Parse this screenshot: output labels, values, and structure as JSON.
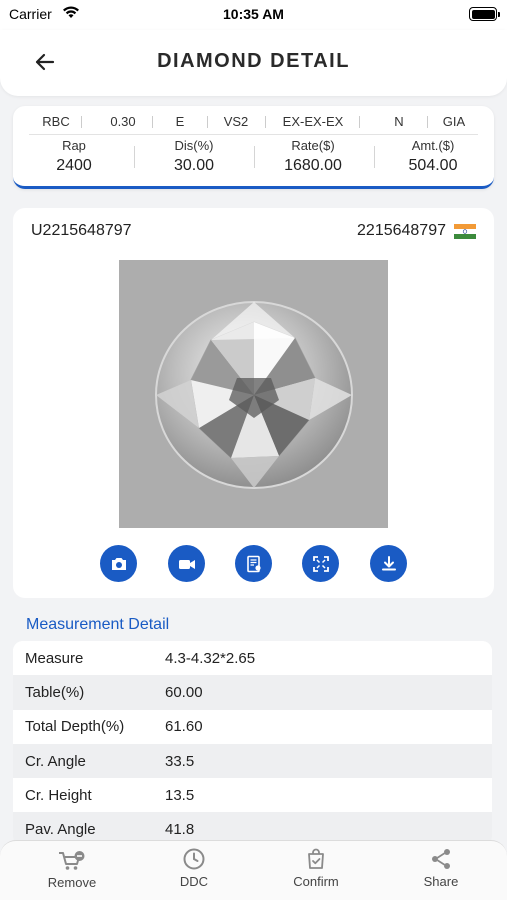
{
  "status_bar": {
    "carrier": "Carrier",
    "time": "10:35 AM"
  },
  "header": {
    "title": "DIAMOND DETAIL"
  },
  "summary": {
    "shape": "RBC",
    "carat": "0.30",
    "color": "E",
    "clarity": "VS2",
    "cut_pol_sym": "EX-EX-EX",
    "fluorescence": "N",
    "lab": "GIA",
    "columns": [
      {
        "label": "Rap",
        "value": "2400"
      },
      {
        "label": "Dis(%)",
        "value": "30.00"
      },
      {
        "label": "Rate($)",
        "value": "1680.00"
      },
      {
        "label": "Amt.($)",
        "value": "504.00"
      }
    ]
  },
  "stone": {
    "stone_id": "U2215648797",
    "certificate_no": "2215648797",
    "origin_flag": "india-flag-icon"
  },
  "actions": [
    "camera-icon",
    "video-icon",
    "certificate-icon",
    "fullscreen-icon",
    "download-icon"
  ],
  "measurement": {
    "title": "Measurement Detail",
    "rows": [
      {
        "key": "Measure",
        "value": "4.3-4.32*2.65"
      },
      {
        "key": "Table(%)",
        "value": "60.00"
      },
      {
        "key": "Total Depth(%)",
        "value": "61.60"
      },
      {
        "key": "Cr. Angle",
        "value": "33.5"
      },
      {
        "key": "Cr. Height",
        "value": "13.5"
      },
      {
        "key": "Pav. Angle",
        "value": "41.8"
      }
    ]
  },
  "bottom_tabs": [
    {
      "label": "Remove",
      "icon": "cart-remove-icon"
    },
    {
      "label": "DDC",
      "icon": "clock-icon"
    },
    {
      "label": "Confirm",
      "icon": "bag-check-icon"
    },
    {
      "label": "Share",
      "icon": "share-icon"
    }
  ],
  "colors": {
    "accent": "#1a5bc4",
    "background": "#f2f3f5"
  }
}
